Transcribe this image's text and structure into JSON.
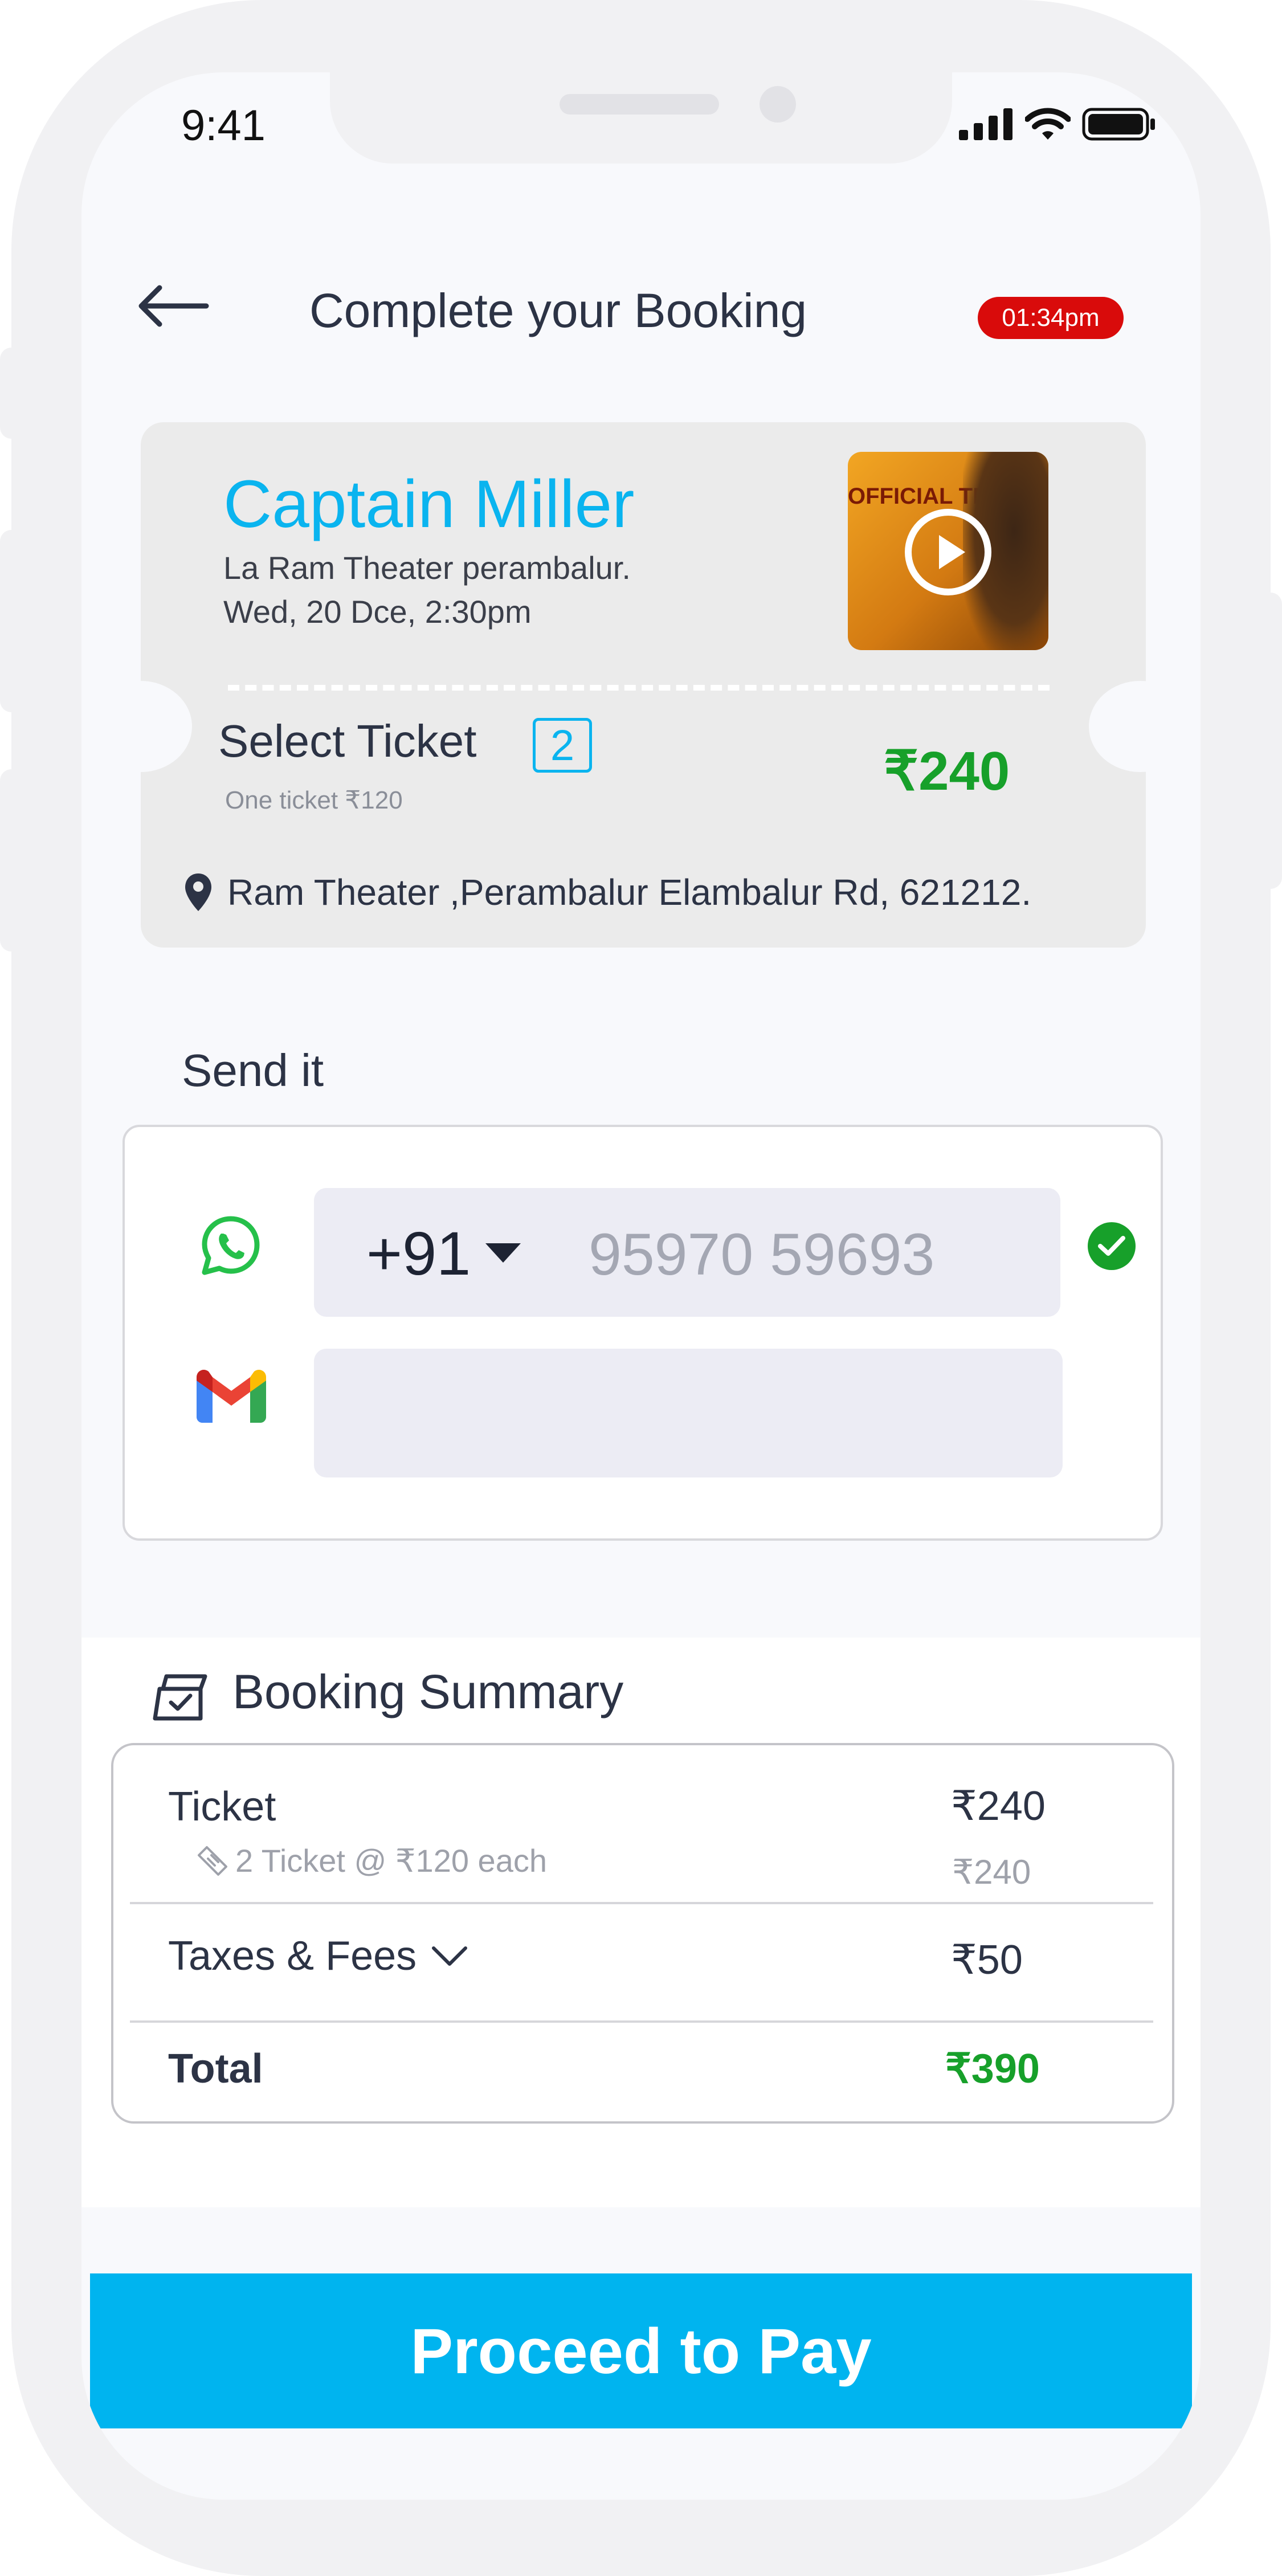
{
  "status_bar": {
    "time": "9:41"
  },
  "header": {
    "title": "Complete your Booking",
    "timer": "01:34pm"
  },
  "movie": {
    "title": "Captain Miller",
    "theater": "La Ram Theater perambalur.",
    "showtime": "Wed, 20 Dce,  2:30pm",
    "poster_text": "OFFICIAL TEASER CAPTAIN MILLER"
  },
  "ticket": {
    "select_label": "Select Ticket",
    "quantity": "2",
    "unit_price_note": "One ticket ₹120",
    "price": "₹240",
    "address": "Ram Theater ,Perambalur Elambalur Rd,  621212."
  },
  "send": {
    "label": "Send it",
    "country_code": "+91",
    "phone": "95970 59693",
    "email_value": ""
  },
  "summary": {
    "title": "Booking Summary",
    "ticket_label": "Ticket",
    "ticket_amount": "₹240",
    "ticket_detail": "2 Ticket @ ₹120 each",
    "ticket_sub_amount": "₹240",
    "taxes_label": "Taxes & Fees",
    "taxes_amount": "₹50",
    "total_label": "Total",
    "total_amount": "₹390"
  },
  "cta": {
    "label": "Proceed to Pay"
  },
  "colors": {
    "accent": "#00b4ef",
    "price_green": "#17a02a",
    "timer_red": "#d90b0b"
  }
}
